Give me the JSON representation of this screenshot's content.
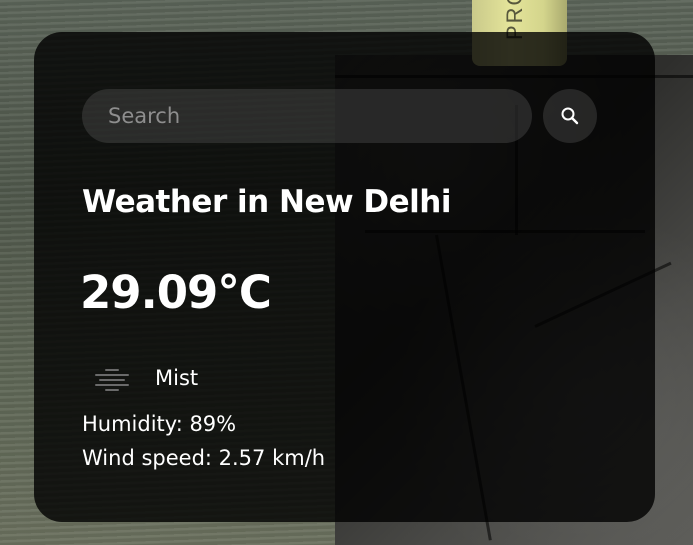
{
  "search": {
    "placeholder": "Search",
    "value": ""
  },
  "weather": {
    "title": "Weather in New Delhi",
    "temperature": "29.09°C",
    "description": "Mist",
    "humidity": "Humidity: 89%",
    "wind": "Wind speed: 2.57 km/h"
  },
  "background": {
    "bottle_text": "PRO"
  },
  "icons": {
    "search": "search-icon",
    "condition": "mist-icon"
  },
  "colors": {
    "card": "#000000",
    "text": "#ffffff",
    "placeholder": "#8e8e8e",
    "input": "#7d7d7d"
  }
}
